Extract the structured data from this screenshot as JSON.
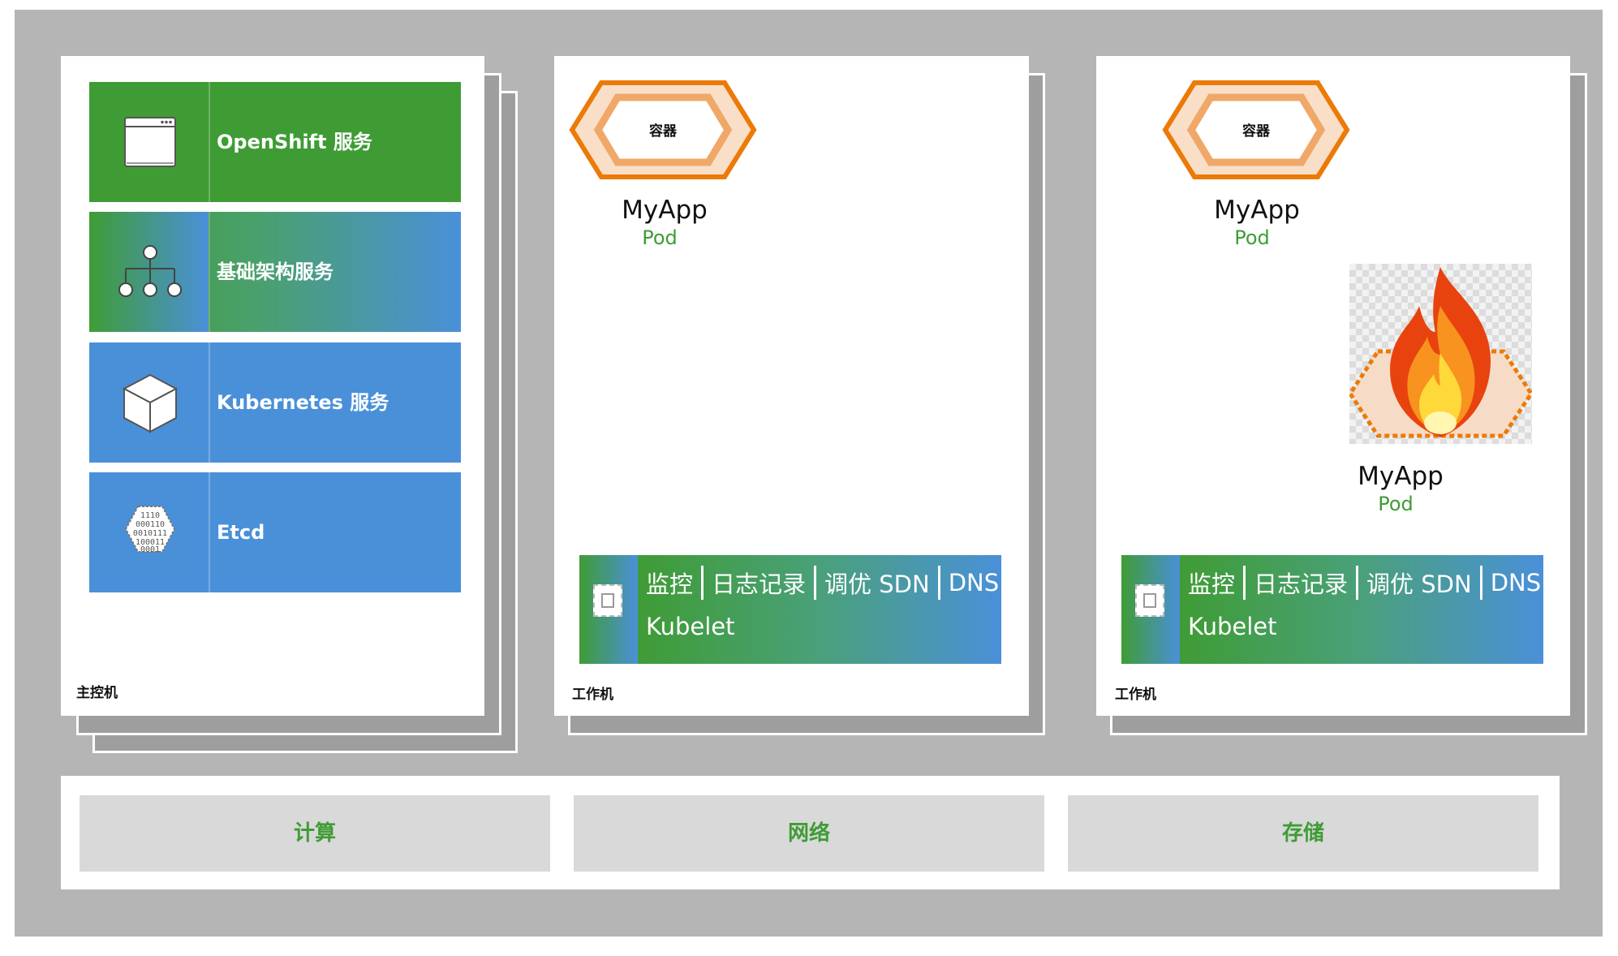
{
  "master": {
    "label": "主控机",
    "services": [
      {
        "label": "OpenShift 服务",
        "icon": "browser-window-icon",
        "style": "green"
      },
      {
        "label": "基础架构服务",
        "icon": "org-tree-icon",
        "style": "gradient"
      },
      {
        "label": "Kubernetes 服务",
        "icon": "cube-icon",
        "style": "blue"
      },
      {
        "label": "Etcd",
        "icon": "binary-hexagon-icon",
        "style": "blue"
      }
    ]
  },
  "workers": [
    {
      "label": "工作机",
      "pods": [
        {
          "container_label": "容器",
          "name": "MyApp",
          "sub": "Pod"
        }
      ],
      "agent": {
        "items": [
          "监控",
          "日志记录",
          "调优 SDN",
          "DNS"
        ],
        "kubelet": "Kubelet"
      }
    },
    {
      "label": "工作机",
      "pods": [
        {
          "container_label": "容器",
          "name": "MyApp",
          "sub": "Pod"
        },
        {
          "name": "MyApp",
          "sub": "Pod",
          "state": "on-fire",
          "icon": "fire-icon"
        }
      ],
      "agent": {
        "items": [
          "监控",
          "日志记录",
          "调优 SDN",
          "DNS"
        ],
        "kubelet": "Kubelet"
      }
    }
  ],
  "infrastructure": [
    "计算",
    "网络",
    "存储"
  ],
  "colors": {
    "green": "#3f9c35",
    "blue": "#4a90d9",
    "orange": "#ec7a08",
    "frame_gray": "#b5b5b5",
    "shadow_gray": "#9e9e9e",
    "resource_gray": "#d9d9d9"
  }
}
